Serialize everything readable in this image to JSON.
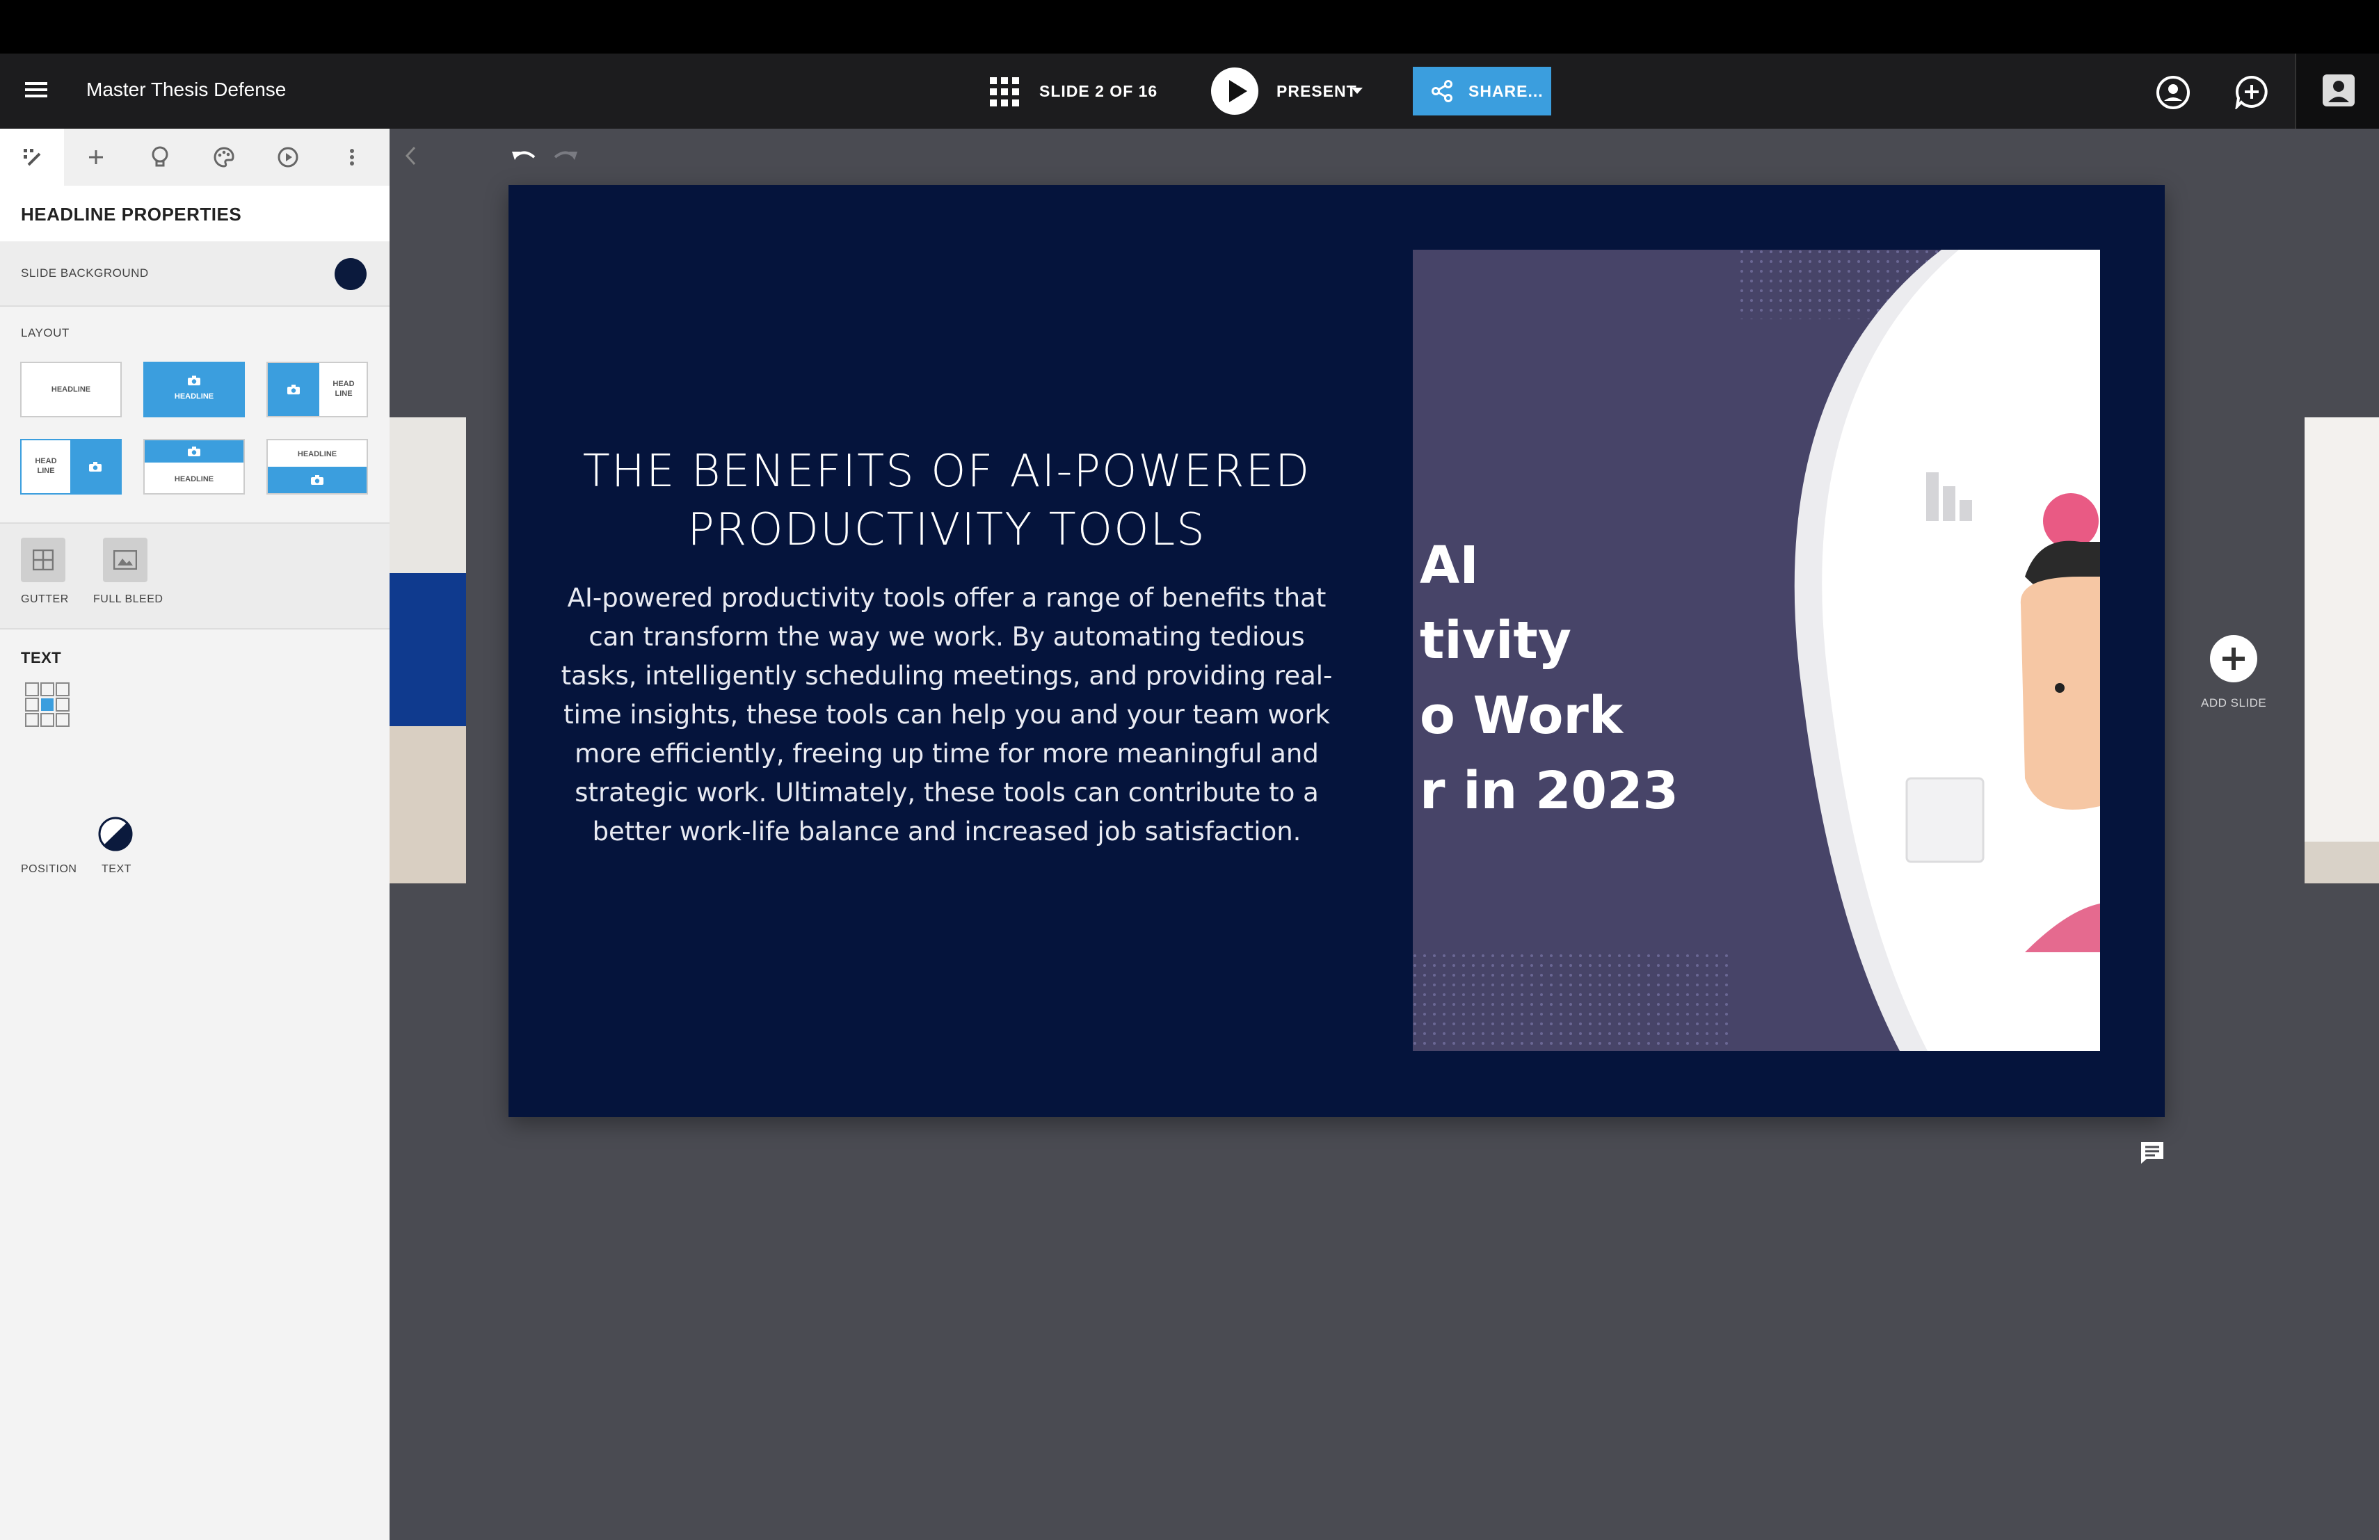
{
  "app": {
    "title": "Master Thesis Defense",
    "slide_counter": "SLIDE 2 OF 16",
    "present_label": "PRESENT",
    "share_label": "SHARE..."
  },
  "sidebar": {
    "panel_title": "HEADLINE PROPERTIES",
    "slide_background_label": "SLIDE BACKGROUND",
    "slide_background_color": "#0b1a3d",
    "layout_label": "LAYOUT",
    "layouts": [
      {
        "label_a": "HEADLINE"
      },
      {
        "label_a": "HEADLINE"
      },
      {
        "label_a": "HEAD",
        "label_b": "LINE"
      },
      {
        "label_a": "HEAD",
        "label_b": "LINE"
      },
      {
        "label_a": "HEADLINE"
      },
      {
        "label_a": "HEADLINE"
      }
    ],
    "gutter_label": "GUTTER",
    "full_bleed_label": "FULL BLEED",
    "text_section_label": "TEXT",
    "position_label": "POSITION",
    "text_label": "TEXT"
  },
  "slide": {
    "heading_line1": "THE BENEFITS OF AI-POWERED",
    "heading_line2": "PRODUCTIVITY TOOLS",
    "body": [
      "AI-powered productivity tools offer a range of benefits that",
      "can transform the way we work. By automating tedious",
      "tasks, intelligently scheduling meetings, and providing real-",
      "time insights, these tools can help you and your team work",
      "more efficiently, freeing up time for more meaningful and",
      "strategic work. Ultimately, these tools can contribute to a",
      "better work-life balance and increased job satisfaction."
    ],
    "image_text": [
      "AI",
      "tivity",
      "o Work",
      "r in 2023"
    ]
  },
  "canvas": {
    "add_slide_label": "ADD SLIDE"
  },
  "colors": {
    "accent": "#3b9ede",
    "slide_bg": "#05143c",
    "image_panel": "#474468"
  }
}
